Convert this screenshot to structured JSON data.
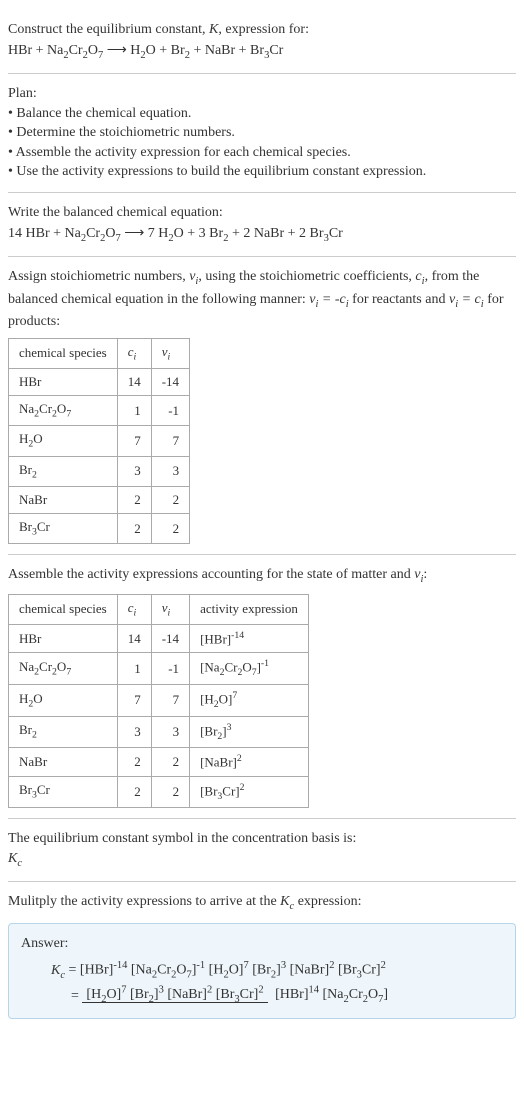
{
  "intro": {
    "line1": "Construct the equilibrium constant, ",
    "k": "K",
    "line1b": ", expression for:",
    "equation": "HBr + Na₂Cr₂O₇ ⟶ H₂O + Br₂ + NaBr + Br₃Cr"
  },
  "plan": {
    "heading": "Plan:",
    "b1": "• Balance the chemical equation.",
    "b2": "• Determine the stoichiometric numbers.",
    "b3": "• Assemble the activity expression for each chemical species.",
    "b4": "• Use the activity expressions to build the equilibrium constant expression."
  },
  "balanced": {
    "heading": "Write the balanced chemical equation:",
    "equation": "14 HBr + Na₂Cr₂O₇ ⟶ 7 H₂O + 3 Br₂ + 2 NaBr + 2 Br₃Cr"
  },
  "stoich": {
    "intro_a": "Assign stoichiometric numbers, ",
    "nu": "νᵢ",
    "intro_b": ", using the stoichiometric coefficients, ",
    "ci": "cᵢ",
    "intro_c": ", from the balanced chemical equation in the following manner: ",
    "rel1": "νᵢ = -cᵢ",
    "intro_d": " for reactants and ",
    "rel2": "νᵢ = cᵢ",
    "intro_e": " for products:",
    "headers": {
      "h1": "chemical species",
      "h2": "cᵢ",
      "h3": "νᵢ"
    },
    "rows": [
      {
        "species": "HBr",
        "c": "14",
        "v": "-14"
      },
      {
        "species": "Na₂Cr₂O₇",
        "c": "1",
        "v": "-1"
      },
      {
        "species": "H₂O",
        "c": "7",
        "v": "7"
      },
      {
        "species": "Br₂",
        "c": "3",
        "v": "3"
      },
      {
        "species": "NaBr",
        "c": "2",
        "v": "2"
      },
      {
        "species": "Br₃Cr",
        "c": "2",
        "v": "2"
      }
    ]
  },
  "activity": {
    "intro_a": "Assemble the activity expressions accounting for the state of matter and ",
    "nu": "νᵢ",
    "intro_b": ":",
    "headers": {
      "h1": "chemical species",
      "h2": "cᵢ",
      "h3": "νᵢ",
      "h4": "activity expression"
    },
    "rows": [
      {
        "species": "HBr",
        "c": "14",
        "v": "-14",
        "expr": "[HBr]⁻¹⁴"
      },
      {
        "species": "Na₂Cr₂O₇",
        "c": "1",
        "v": "-1",
        "expr": "[Na₂Cr₂O₇]⁻¹"
      },
      {
        "species": "H₂O",
        "c": "7",
        "v": "7",
        "expr": "[H₂O]⁷"
      },
      {
        "species": "Br₂",
        "c": "3",
        "v": "3",
        "expr": "[Br₂]³"
      },
      {
        "species": "NaBr",
        "c": "2",
        "v": "2",
        "expr": "[NaBr]²"
      },
      {
        "species": "Br₃Cr",
        "c": "2",
        "v": "2",
        "expr": "[Br₃Cr]²"
      }
    ]
  },
  "symbol": {
    "line1": "The equilibrium constant symbol in the concentration basis is:",
    "kc": "K_c"
  },
  "multiply": {
    "line1a": "Mulitply the activity expressions to arrive at the ",
    "kc": "K_c",
    "line1b": " expression:"
  },
  "answer": {
    "label": "Answer:",
    "lhs": "K_c = ",
    "rhs_flat": "[HBr]⁻¹⁴ [Na₂Cr₂O₇]⁻¹ [H₂O]⁷ [Br₂]³ [NaBr]² [Br₃Cr]²",
    "eq2_pre": "= ",
    "frac_num": "[H₂O]⁷ [Br₂]³ [NaBr]² [Br₃Cr]²",
    "frac_den": "[HBr]¹⁴ [Na₂Cr₂O₇]"
  }
}
